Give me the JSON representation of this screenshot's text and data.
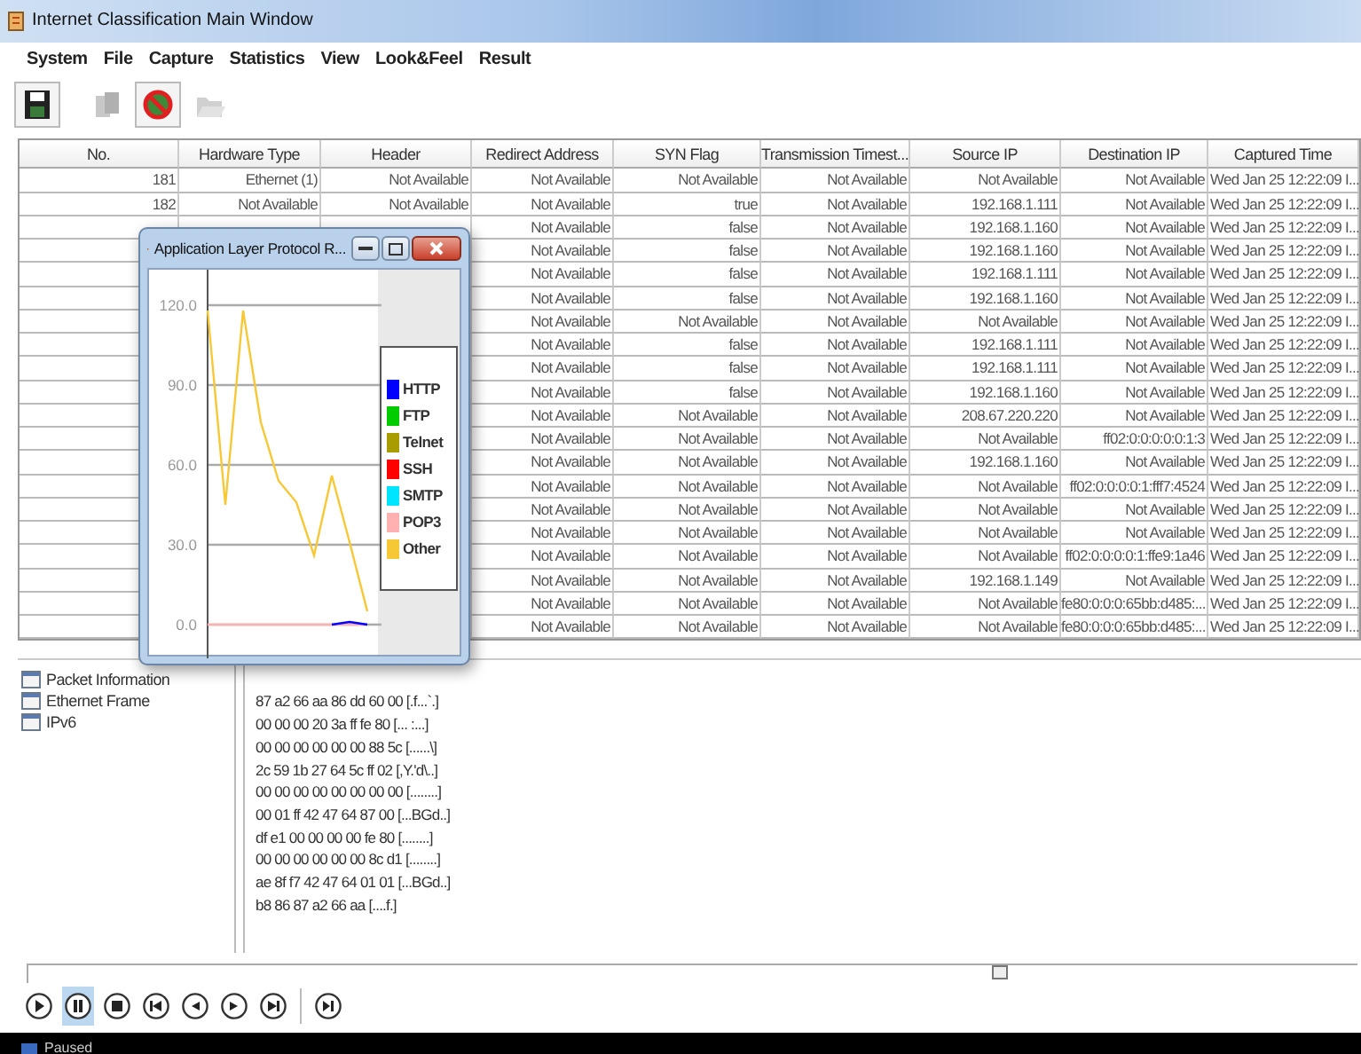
{
  "window": {
    "title": "Internet Classification Main Window"
  },
  "menu": [
    "System",
    "File",
    "Capture",
    "Statistics",
    "View",
    "Look&Feel",
    "Result"
  ],
  "toolbar": [
    {
      "kind": "save",
      "disabled": false
    },
    {
      "kind": "copy",
      "disabled": true
    },
    {
      "kind": "stop",
      "disabled": false
    },
    {
      "kind": "open",
      "disabled": true
    }
  ],
  "table": {
    "columns": [
      "No.",
      "Hardware Type",
      "Header",
      "Redirect Address",
      "SYN Flag",
      "Transmission Timest...",
      "Source IP",
      "Destination IP",
      "Captured Time"
    ],
    "rows": [
      {
        "cells": [
          "181",
          "Ethernet (1)",
          "Not Available",
          "Not Available",
          "Not Available",
          "Not Available",
          "Not Available",
          "Not Available",
          "Wed Jan 25 12:22:09 I..."
        ]
      },
      {
        "cells": [
          "182",
          "Not Available",
          "Not Available",
          "Not Available",
          "true",
          "Not Available",
          "192.168.1.111",
          "Not Available",
          "Wed Jan 25 12:22:09 I..."
        ]
      },
      {
        "cells": [
          "Not Available",
          "false",
          "Not Available",
          "192.168.1.160",
          "Not Available",
          "Wed Jan 25 12:22:09 I..."
        ]
      },
      {
        "cells": [
          "Not Available",
          "false",
          "Not Available",
          "192.168.1.160",
          "Not Available",
          "Wed Jan 25 12:22:09 I..."
        ]
      },
      {
        "cells": [
          "Not Available",
          "false",
          "Not Available",
          "192.168.1.111",
          "Not Available",
          "Wed Jan 25 12:22:09 I..."
        ]
      },
      {
        "cells": [
          "Not Available",
          "false",
          "Not Available",
          "192.168.1.160",
          "Not Available",
          "Wed Jan 25 12:22:09 I..."
        ]
      },
      {
        "cells": [
          "Not Available",
          "Not Available",
          "Not Available",
          "Not Available",
          "Not Available",
          "Wed Jan 25 12:22:09 I..."
        ]
      },
      {
        "cells": [
          "Not Available",
          "false",
          "Not Available",
          "192.168.1.111",
          "Not Available",
          "Wed Jan 25 12:22:09 I..."
        ]
      },
      {
        "cells": [
          "Not Available",
          "false",
          "Not Available",
          "192.168.1.111",
          "Not Available",
          "Wed Jan 25 12:22:09 I..."
        ]
      },
      {
        "cells": [
          "Not Available",
          "false",
          "Not Available",
          "192.168.1.160",
          "Not Available",
          "Wed Jan 25 12:22:09 I..."
        ]
      },
      {
        "cells": [
          "Not Available",
          "Not Available",
          "Not Available",
          "208.67.220.220",
          "Not Available",
          "Wed Jan 25 12:22:09 I..."
        ]
      },
      {
        "cells": [
          "Not Available",
          "Not Available",
          "Not Available",
          "Not Available",
          "ff02:0:0:0:0:0:1:3",
          "Wed Jan 25 12:22:09 I..."
        ]
      },
      {
        "cells": [
          "Not Available",
          "Not Available",
          "Not Available",
          "192.168.1.160",
          "Not Available",
          "Wed Jan 25 12:22:09 I..."
        ]
      },
      {
        "cells": [
          "Not Available",
          "Not Available",
          "Not Available",
          "Not Available",
          "ff02:0:0:0:0:1:fff7:4524",
          "Wed Jan 25 12:22:09 I..."
        ]
      },
      {
        "cells": [
          "Not Available",
          "Not Available",
          "Not Available",
          "Not Available",
          "Not Available",
          "Wed Jan 25 12:22:09 I..."
        ]
      },
      {
        "cells": [
          "Not Available",
          "Not Available",
          "Not Available",
          "Not Available",
          "Not Available",
          "Wed Jan 25 12:22:09 I..."
        ]
      },
      {
        "cells": [
          "Not Available",
          "Not Available",
          "Not Available",
          "Not Available",
          "ff02:0:0:0:0:1:ffe9:1a46",
          "Wed Jan 25 12:22:09 I..."
        ]
      },
      {
        "cells": [
          "Not Available",
          "Not Available",
          "Not Available",
          "192.168.1.149",
          "Not Available",
          "Wed Jan 25 12:22:09 I..."
        ]
      },
      {
        "cells": [
          "Not Available",
          "Not Available",
          "Not Available",
          "Not Available",
          "fe80:0:0:0:65bb:d485:...",
          "Wed Jan 25 12:22:09 I..."
        ]
      },
      {
        "cells": [
          "Not Available",
          "Not Available",
          "Not Available",
          "Not Available",
          "fe80:0:0:0:65bb:d485:...",
          "Wed Jan 25 12:22:09 I..."
        ]
      }
    ]
  },
  "dialog": {
    "title": "Application Layer Protocol R...",
    "chart_data": {
      "type": "line",
      "grid": true,
      "legend": true,
      "ylim": [
        0,
        120
      ],
      "yticks": [
        {
          "value": 0,
          "label": "0.0"
        },
        {
          "value": 30,
          "label": "30.0"
        },
        {
          "value": 60,
          "label": "60.0"
        },
        {
          "value": 90,
          "label": "90.0"
        },
        {
          "value": 120,
          "label": "120.0"
        }
      ],
      "series": [
        {
          "name": "HTTP",
          "color": "#0000ff",
          "values": [
            null,
            null,
            null,
            null,
            null,
            null,
            null,
            0,
            1,
            0,
            null
          ]
        },
        {
          "name": "FTP",
          "color": "#00cc00",
          "values": [
            null,
            null,
            null,
            null,
            null,
            null,
            null,
            null,
            null,
            null,
            null
          ]
        },
        {
          "name": "Telnet",
          "color": "#a89c00",
          "values": [
            null,
            null,
            null,
            null,
            null,
            null,
            null,
            null,
            null,
            null,
            null
          ]
        },
        {
          "name": "SSH",
          "color": "#ff0000",
          "values": [
            null,
            null,
            null,
            null,
            null,
            null,
            null,
            null,
            null,
            null,
            null
          ]
        },
        {
          "name": "SMTP",
          "color": "#00e5ff",
          "values": [
            null,
            null,
            null,
            null,
            null,
            null,
            null,
            null,
            null,
            null,
            null
          ]
        },
        {
          "name": "POP3",
          "color": "#ffb0b0",
          "values": [
            0,
            0,
            0,
            0,
            0,
            0,
            0,
            0,
            0,
            0,
            null
          ]
        },
        {
          "name": "Other",
          "color": "#f7c836",
          "values": [
            118,
            45,
            118,
            76,
            54,
            46,
            26,
            56,
            31,
            5,
            null
          ]
        }
      ]
    }
  },
  "detail": {
    "tree": [
      "Packet Information",
      "Ethernet Frame",
      "IPv6"
    ],
    "hex": [
      "87 a2 66 aa 86 dd 60 00 [.f...`.]",
      "00 00 00 20 3a ff fe 80 [... :...]",
      "00 00 00 00 00 00 88 5c [......\\]",
      "2c 59 1b 27 64 5c ff 02 [,Y.'d\\..]",
      "00 00 00 00 00 00 00 00 [........]",
      "00 01 ff 42 47 64 87 00 [...BGd..]",
      "df e1 00 00 00 00 fe 80 [........]",
      "00 00 00 00 00 00 8c d1 [........]",
      "ae 8f f7 42 47 64 01 01 [...BGd..]",
      "b8 86 87 a2 66 aa [....f.]"
    ]
  },
  "player": {
    "seek": {
      "level": 0.73
    },
    "controls": [
      {
        "kind": "play",
        "selected": false
      },
      {
        "kind": "pause",
        "selected": true
      },
      {
        "kind": "stop",
        "selected": false
      },
      {
        "kind": "first",
        "selected": false
      },
      {
        "kind": "back",
        "selected": false
      },
      {
        "kind": "forward",
        "selected": false
      },
      {
        "kind": "last",
        "selected": false
      },
      {
        "kind": "frame",
        "selected": false
      }
    ],
    "status": "Paused"
  }
}
